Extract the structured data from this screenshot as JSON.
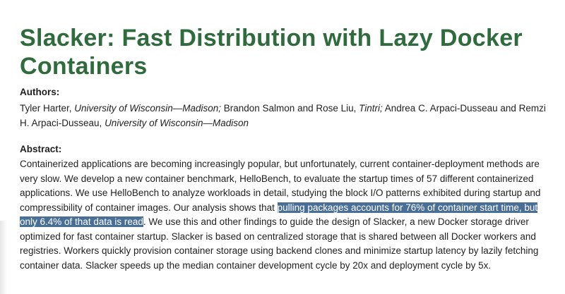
{
  "paper": {
    "title": "Slacker: Fast Distribution with Lazy Docker Containers",
    "authors_label": "Authors:",
    "authors": [
      {
        "names": "Tyler Harter, ",
        "affiliation": "University of Wisconsin—Madison;",
        "sep": " "
      },
      {
        "names": "Brandon Salmon and Rose Liu, ",
        "affiliation": "Tintri;",
        "sep": " "
      },
      {
        "names": "Andrea C. Arpaci-Dusseau and Remzi H. Arpaci-Dusseau, ",
        "affiliation": "University of Wisconsin—Madison",
        "sep": ""
      }
    ],
    "abstract_label": "Abstract:",
    "abstract_before": "Containerized applications are becoming increasingly popular, but unfortunately, current container-deployment methods are very slow. We develop a new container benchmark, HelloBench, to evaluate the startup times of 57 different containerized applications. We use HelloBench to analyze workloads in detail, studying the block I/O patterns exhibited during startup and compressibility of container images. Our analysis shows that ",
    "abstract_highlight": "pulling packages accounts for 76% of container start time, but only 6.4% of that data is read",
    "abstract_after": ". We use this and other findings to guide the design of Slacker, a new Docker storage driver optimized for fast container startup. Slacker is based on centralized storage that is shared between all Docker workers and registries. Workers quickly provision container storage using backend clones and minimize startup latency by lazily fetching container data. Slacker speeds up the median container development cycle by 20x and deployment cycle by 5x."
  },
  "colors": {
    "title": "#2f6b3d",
    "highlight_bg": "#4a6f97",
    "highlight_text": "#ffffff"
  }
}
